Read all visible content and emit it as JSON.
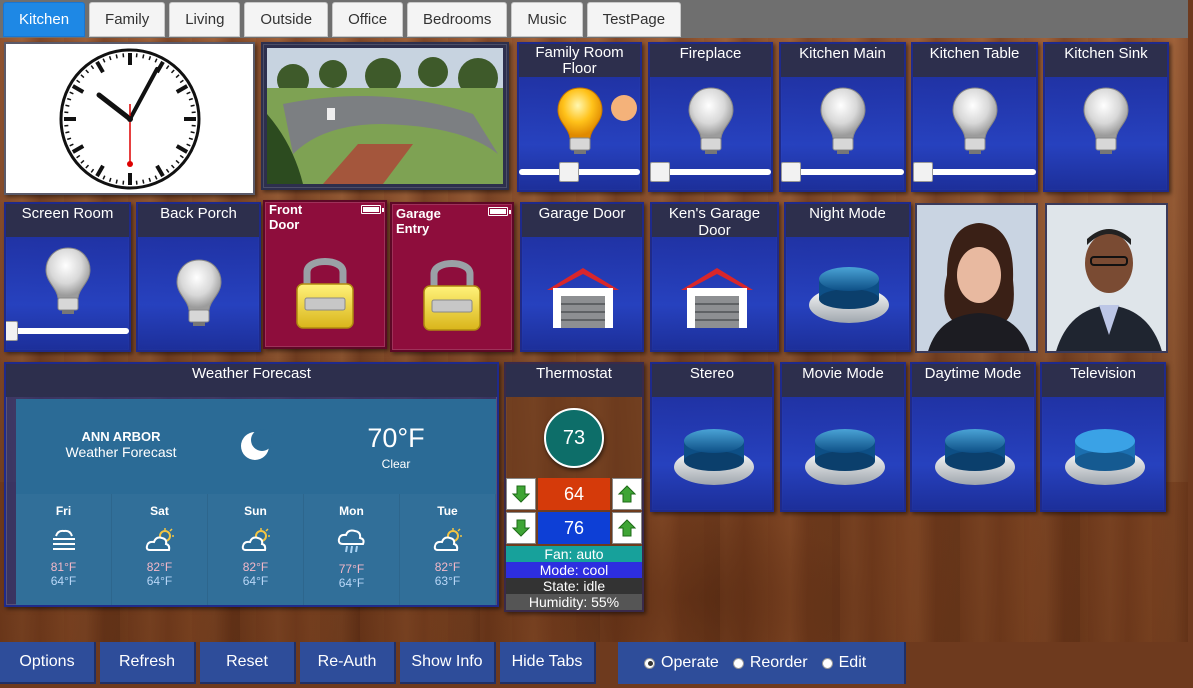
{
  "tabs": [
    {
      "label": "Kitchen",
      "active": true
    },
    {
      "label": "Family"
    },
    {
      "label": "Living"
    },
    {
      "label": "Outside"
    },
    {
      "label": "Office"
    },
    {
      "label": "Bedrooms"
    },
    {
      "label": "Music"
    },
    {
      "label": "TestPage"
    }
  ],
  "lights": {
    "family_room_floor": {
      "line1": "Family Room",
      "line2": "Floor",
      "state": "on",
      "level": 40
    },
    "fireplace": {
      "name": "Fireplace",
      "state": "off",
      "level": 0
    },
    "kitchen_main": {
      "name": "Kitchen Main",
      "state": "off",
      "level": 0
    },
    "kitchen_table": {
      "name": "Kitchen Table",
      "state": "off",
      "level": 0
    },
    "kitchen_sink": {
      "name": "Kitchen Sink",
      "state": "off"
    },
    "screen_room": {
      "name": "Screen Room",
      "state": "off",
      "level": 0
    },
    "back_porch": {
      "name": "Back Porch",
      "state": "off"
    }
  },
  "locks": {
    "front_door": {
      "line1": "Front",
      "line2": "Door",
      "state": "locked"
    },
    "garage_entry": {
      "line1": "Garage",
      "line2": "Entry",
      "state": "locked"
    }
  },
  "garage": {
    "garage_door": {
      "name": "Garage Door",
      "state": "closed"
    },
    "kens_garage_door": {
      "name": "Ken's Garage Door",
      "state": "closed"
    }
  },
  "buttons": {
    "night_mode": "Night Mode",
    "stereo": "Stereo",
    "movie_mode": "Movie Mode",
    "daytime_mode": "Daytime Mode",
    "television": "Television"
  },
  "weather": {
    "title": "Weather Forecast",
    "city": "ANN ARBOR",
    "subtitle": "Weather Forecast",
    "current_temp": "70°F",
    "condition": "Clear",
    "current_icon": "moon-icon",
    "days": [
      {
        "name": "Fri",
        "hi": "81°F",
        "lo": "64°F",
        "icon": "fog-icon"
      },
      {
        "name": "Sat",
        "hi": "82°F",
        "lo": "64°F",
        "icon": "partly-cloudy-icon"
      },
      {
        "name": "Sun",
        "hi": "82°F",
        "lo": "64°F",
        "icon": "partly-cloudy-icon"
      },
      {
        "name": "Mon",
        "hi": "77°F",
        "lo": "64°F",
        "icon": "rain-icon"
      },
      {
        "name": "Tue",
        "hi": "82°F",
        "lo": "63°F",
        "icon": "partly-cloudy-icon"
      }
    ]
  },
  "thermostat": {
    "title": "Thermostat",
    "current": "73",
    "heat_setpoint": "64",
    "cool_setpoint": "76",
    "fan": "Fan: auto",
    "mode": "Mode: cool",
    "state": "State: idle",
    "humidity": "Humidity: 55%"
  },
  "footer": {
    "options": "Options",
    "refresh": "Refresh",
    "reset": "Reset",
    "reauth": "Re-Auth",
    "show_info": "Show Info",
    "hide_tabs": "Hide Tabs",
    "operate": "Operate",
    "reorder": "Reorder",
    "edit": "Edit",
    "selected_mode": "Operate"
  },
  "colors": {
    "accent": "#1e88e5",
    "tile_blue": "#2643c4",
    "lock_red": "#8e0d3c",
    "heat": "#d53a0a",
    "cool": "#0d3fd6",
    "fan_bg": "#17a19b",
    "mode_bg": "#2d2ee0"
  }
}
